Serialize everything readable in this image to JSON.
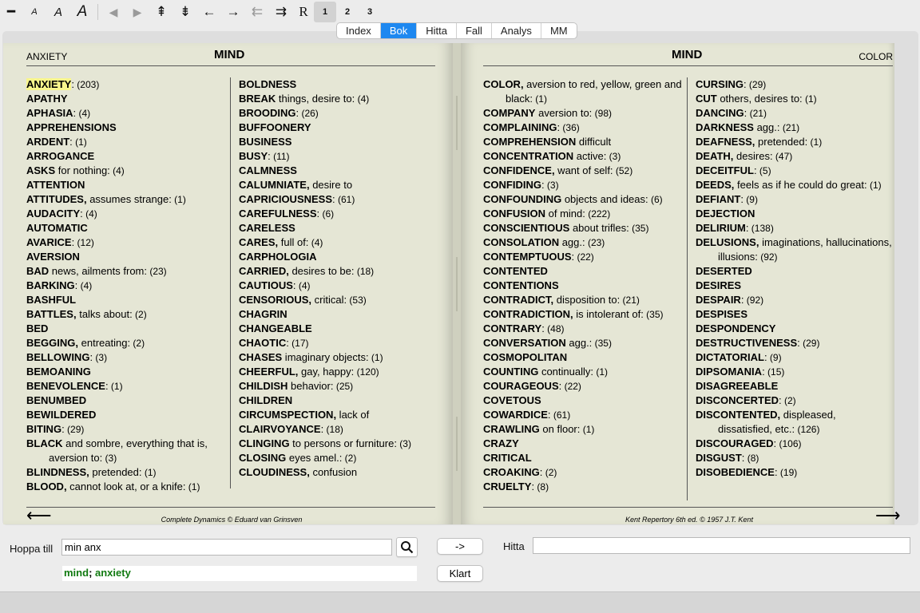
{
  "toolbar": {
    "icons": [
      {
        "name": "minus-icon",
        "glyph": "━"
      },
      {
        "name": "font-small-icon",
        "glyph": "A"
      },
      {
        "name": "font-medium-icon",
        "glyph": "A"
      },
      {
        "name": "font-large-icon",
        "glyph": "A"
      },
      {
        "name": "triangle-left-icon",
        "glyph": "◀"
      },
      {
        "name": "triangle-right-icon",
        "glyph": "▶"
      },
      {
        "name": "double-up-arrow-icon",
        "glyph": "⇞"
      },
      {
        "name": "double-down-arrow-icon",
        "glyph": "⇟"
      },
      {
        "name": "arrow-left-icon",
        "glyph": "←"
      },
      {
        "name": "arrow-right-icon",
        "glyph": "→"
      },
      {
        "name": "double-arrow-left-icon",
        "glyph": "⇇"
      },
      {
        "name": "double-arrow-right-icon",
        "glyph": "⇉"
      },
      {
        "name": "r-icon",
        "glyph": "R"
      }
    ],
    "numbers": [
      "1",
      "2",
      "3"
    ]
  },
  "tabs": [
    "Index",
    "Bok",
    "Hitta",
    "Fall",
    "Analys",
    "MM"
  ],
  "left_page": {
    "section": "ANXIETY",
    "title": "MIND",
    "footer": "Complete Dynamics © Eduard van Grinsven",
    "col1": [
      {
        "h": "ANXIETY",
        "t": ":",
        "c": " (203)",
        "hl": true
      },
      {
        "h": "APATHY",
        "t": "",
        "c": ""
      },
      {
        "h": "APHASIA",
        "t": ":",
        "c": " (4)"
      },
      {
        "h": "APPREHENSIONS",
        "t": "",
        "c": ""
      },
      {
        "h": "ARDENT",
        "t": ":",
        "c": " (1)"
      },
      {
        "h": "ARROGANCE",
        "t": "",
        "c": ""
      },
      {
        "h": "ASKS",
        "t": " for nothing:",
        "c": " (4)"
      },
      {
        "h": "ATTENTION",
        "t": "",
        "c": ""
      },
      {
        "h": "ATTITUDES,",
        "t": " assumes strange:",
        "c": " (1)"
      },
      {
        "h": "AUDACITY",
        "t": ":",
        "c": " (4)"
      },
      {
        "h": "AUTOMATIC",
        "t": "",
        "c": ""
      },
      {
        "h": "AVARICE",
        "t": ":",
        "c": " (12)"
      },
      {
        "h": "AVERSION",
        "t": "",
        "c": ""
      },
      {
        "h": "BAD",
        "t": " news, ailments from:",
        "c": " (23)"
      },
      {
        "h": "BARKING",
        "t": ":",
        "c": " (4)"
      },
      {
        "h": "BASHFUL",
        "t": "",
        "c": ""
      },
      {
        "h": "BATTLES,",
        "t": " talks about:",
        "c": " (2)"
      },
      {
        "h": "BED",
        "t": "",
        "c": ""
      },
      {
        "h": "BEGGING,",
        "t": " entreating:",
        "c": " (2)"
      },
      {
        "h": "BELLOWING",
        "t": ":",
        "c": " (3)"
      },
      {
        "h": "BEMOANING",
        "t": "",
        "c": ""
      },
      {
        "h": "BENEVOLENCE",
        "t": ":",
        "c": " (1)"
      },
      {
        "h": "BENUMBED",
        "t": "",
        "c": ""
      },
      {
        "h": "BEWILDERED",
        "t": "",
        "c": ""
      },
      {
        "h": "BITING",
        "t": ":",
        "c": " (29)"
      },
      {
        "h": "BLACK",
        "t": " and sombre, everything that is, aversion to:",
        "c": " (3)"
      },
      {
        "h": "BLINDNESS,",
        "t": " pretended:",
        "c": " (1)"
      },
      {
        "h": "BLOOD,",
        "t": " cannot look at, or a knife:",
        "c": "   (1)"
      }
    ],
    "col2": [
      {
        "h": "BOLDNESS",
        "t": "",
        "c": ""
      },
      {
        "h": "BREAK",
        "t": " things, desire to:",
        "c": " (4)"
      },
      {
        "h": "BROODING",
        "t": ":",
        "c": " (26)"
      },
      {
        "h": "BUFFOONERY",
        "t": "",
        "c": ""
      },
      {
        "h": "BUSINESS",
        "t": "",
        "c": ""
      },
      {
        "h": "BUSY",
        "t": ":",
        "c": " (11)"
      },
      {
        "h": "CALMNESS",
        "t": "",
        "c": ""
      },
      {
        "h": "CALUMNIATE,",
        "t": " desire to",
        "c": ""
      },
      {
        "h": "CAPRICIOUSNESS",
        "t": ":",
        "c": " (61)"
      },
      {
        "h": "CAREFULNESS",
        "t": ":",
        "c": " (6)"
      },
      {
        "h": "CARELESS",
        "t": "",
        "c": ""
      },
      {
        "h": "CARES,",
        "t": " full of:",
        "c": " (4)"
      },
      {
        "h": "CARPHOLOGIA",
        "t": "",
        "c": ""
      },
      {
        "h": "CARRIED,",
        "t": " desires to be:",
        "c": " (18)"
      },
      {
        "h": "CAUTIOUS",
        "t": ":",
        "c": " (4)"
      },
      {
        "h": "CENSORIOUS,",
        "t": " critical:",
        "c": " (53)"
      },
      {
        "h": "CHAGRIN",
        "t": "",
        "c": ""
      },
      {
        "h": "CHANGEABLE",
        "t": "",
        "c": ""
      },
      {
        "h": "CHAOTIC",
        "t": ":",
        "c": " (17)"
      },
      {
        "h": "CHASES",
        "t": " imaginary objects:",
        "c": " (1)"
      },
      {
        "h": "CHEERFUL,",
        "t": " gay, happy:",
        "c": " (120)"
      },
      {
        "h": "CHILDISH",
        "t": " behavior:",
        "c": " (25)"
      },
      {
        "h": "CHILDREN",
        "t": "",
        "c": ""
      },
      {
        "h": "CIRCUMSPECTION,",
        "t": " lack of",
        "c": ""
      },
      {
        "h": "CLAIRVOYANCE",
        "t": ":",
        "c": " (18)"
      },
      {
        "h": "CLINGING",
        "t": " to persons or furniture:",
        "c": " (3)"
      },
      {
        "h": "CLOSING",
        "t": " eyes amel.:",
        "c": " (2)"
      },
      {
        "h": "CLOUDINESS,",
        "t": " confusion",
        "c": ""
      }
    ]
  },
  "right_page": {
    "section": "COLOR",
    "title": "MIND",
    "footer": "Kent Repertory 6th ed. © 1957 J.T. Kent",
    "col1": [
      {
        "h": "COLOR,",
        "t": " aversion to red, yellow, green and black:",
        "c": " (1)"
      },
      {
        "h": "COMPANY",
        "t": " aversion to:",
        "c": " (98)"
      },
      {
        "h": "COMPLAINING",
        "t": ":",
        "c": " (36)"
      },
      {
        "h": "COMPREHENSION",
        "t": " difficult",
        "c": ""
      },
      {
        "h": "CONCENTRATION",
        "t": " active:",
        "c": " (3)"
      },
      {
        "h": "CONFIDENCE,",
        "t": " want of self:",
        "c": " (52)"
      },
      {
        "h": "CONFIDING",
        "t": ":",
        "c": " (3)"
      },
      {
        "h": "CONFOUNDING",
        "t": " objects and ideas:",
        "c": "  (6)"
      },
      {
        "h": "CONFUSION",
        "t": " of mind:",
        "c": " (222)"
      },
      {
        "h": "CONSCIENTIOUS",
        "t": " about trifles:",
        "c": " (35)"
      },
      {
        "h": "CONSOLATION",
        "t": " agg.:",
        "c": " (23)"
      },
      {
        "h": "CONTEMPTUOUS",
        "t": ":",
        "c": " (22)"
      },
      {
        "h": "CONTENTED",
        "t": "",
        "c": ""
      },
      {
        "h": "CONTENTIONS",
        "t": "",
        "c": ""
      },
      {
        "h": "CONTRADICT,",
        "t": " disposition to:",
        "c": " (21)"
      },
      {
        "h": "CONTRADICTION,",
        "t": " is intolerant of:",
        "c": "  (35)"
      },
      {
        "h": "CONTRARY",
        "t": ":",
        "c": " (48)"
      },
      {
        "h": "CONVERSATION",
        "t": " agg.:",
        "c": " (35)"
      },
      {
        "h": "COSMOPOLITAN",
        "t": "",
        "c": ""
      },
      {
        "h": "COUNTING",
        "t": " continually:",
        "c": " (1)"
      },
      {
        "h": "COURAGEOUS",
        "t": ":",
        "c": " (22)"
      },
      {
        "h": "COVETOUS",
        "t": "",
        "c": ""
      },
      {
        "h": "COWARDICE",
        "t": ":",
        "c": " (61)"
      },
      {
        "h": "CRAWLING",
        "t": " on floor:",
        "c": " (1)"
      },
      {
        "h": "CRAZY",
        "t": "",
        "c": ""
      },
      {
        "h": "CRITICAL",
        "t": "",
        "c": ""
      },
      {
        "h": "CROAKING",
        "t": ":",
        "c": " (2)"
      },
      {
        "h": "CRUELTY",
        "t": ":",
        "c": " (8)"
      }
    ],
    "col2": [
      {
        "h": "CURSING",
        "t": ":",
        "c": " (29)"
      },
      {
        "h": "CUT",
        "t": " others, desires to:",
        "c": " (1)"
      },
      {
        "h": "DANCING",
        "t": ":",
        "c": " (21)"
      },
      {
        "h": "DARKNESS",
        "t": " agg.:",
        "c": " (21)"
      },
      {
        "h": "DEAFNESS,",
        "t": " pretended:",
        "c": " (1)"
      },
      {
        "h": "DEATH,",
        "t": " desires:",
        "c": " (47)"
      },
      {
        "h": "DECEITFUL",
        "t": ":",
        "c": " (5)"
      },
      {
        "h": "DEEDS,",
        "t": " feels as if he could do great:",
        "c": " (1)"
      },
      {
        "h": "DEFIANT",
        "t": ":",
        "c": " (9)"
      },
      {
        "h": "DEJECTION",
        "t": "",
        "c": ""
      },
      {
        "h": "DELIRIUM",
        "t": ":",
        "c": " (138)"
      },
      {
        "h": "DELUSIONS,",
        "t": " imaginations, hallucinations, illusions:",
        "c": " (92)"
      },
      {
        "h": "DESERTED",
        "t": "",
        "c": ""
      },
      {
        "h": "DESIRES",
        "t": "",
        "c": ""
      },
      {
        "h": "DESPAIR",
        "t": ":",
        "c": " (92)"
      },
      {
        "h": "DESPISES",
        "t": "",
        "c": ""
      },
      {
        "h": "DESPONDENCY",
        "t": "",
        "c": ""
      },
      {
        "h": "DESTRUCTIVENESS",
        "t": ":",
        "c": " (29)"
      },
      {
        "h": "DICTATORIAL",
        "t": ":",
        "c": " (9)"
      },
      {
        "h": "DIPSOMANIA",
        "t": ":",
        "c": " (15)"
      },
      {
        "h": "DISAGREEABLE",
        "t": "",
        "c": ""
      },
      {
        "h": "DISCONCERTED",
        "t": ":",
        "c": " (2)"
      },
      {
        "h": "DISCONTENTED,",
        "t": " displeased, dissatisfied, etc.:",
        "c": " (126)"
      },
      {
        "h": "DISCOURAGED",
        "t": ":",
        "c": " (106)"
      },
      {
        "h": "DISGUST",
        "t": ":",
        "c": " (8)"
      },
      {
        "h": "DISOBEDIENCE",
        "t": ":",
        "c": " (19)"
      }
    ]
  },
  "bottom": {
    "jump_label": "Hoppa till",
    "jump_value": "min anx",
    "result_mind": "mind",
    "result_sep": "; ",
    "result_anxiety": "anxiety",
    "go_label": "->",
    "find_label": "Hitta",
    "find_value": "",
    "clear_label": "Klart"
  }
}
